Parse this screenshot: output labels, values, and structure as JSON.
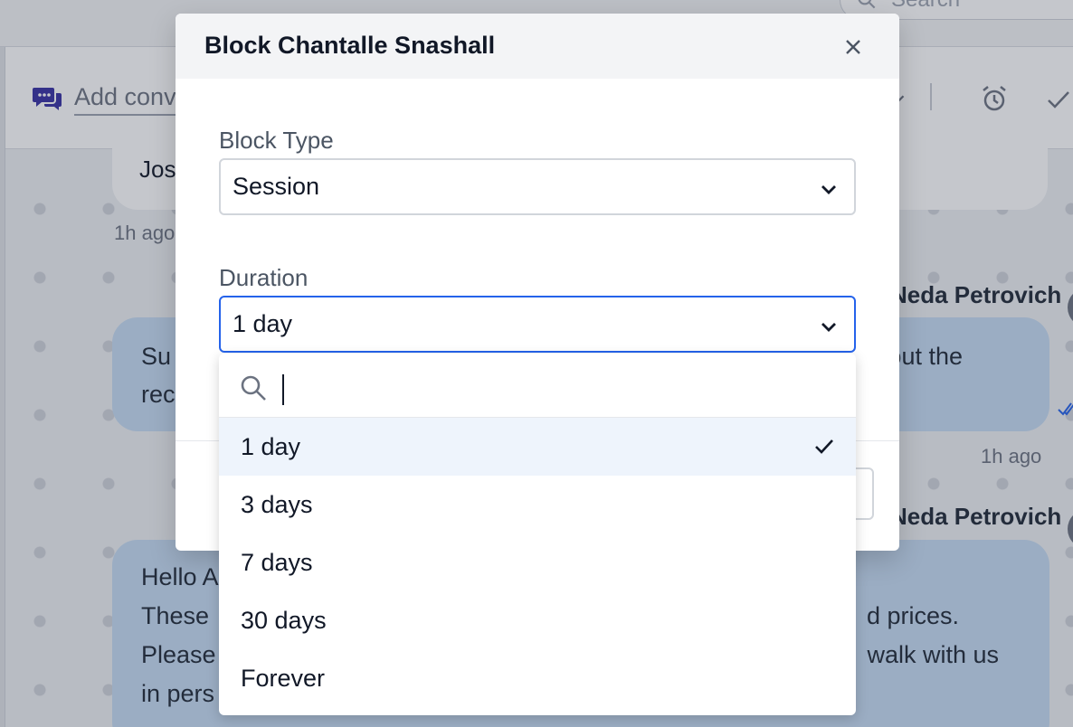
{
  "app": {
    "search_placeholder": "Search",
    "conversation_input_placeholder": "Add conversation title"
  },
  "chat": {
    "incoming_snippet": "Jos",
    "incoming_time": "1h ago",
    "message_1": {
      "sender": "Neda Petrovich",
      "line1_start": "Su",
      "line1_end": "out the",
      "line2_start": "rec"
    },
    "message_2_time": "1h ago",
    "message_2": {
      "sender": "Neda Petrovich",
      "line1_start": "Hello A",
      "line2_start": "These",
      "line2_end": "d prices.",
      "line3_start": "Please",
      "line3_end": "walk with us",
      "line4_start": "in pers"
    }
  },
  "modal": {
    "title": "Block Chantalle Snashall",
    "block_type_label": "Block Type",
    "block_type_value": "Session",
    "duration_label": "Duration",
    "duration_value": "1 day"
  },
  "dropdown": {
    "search_value": "",
    "options": [
      "1 day",
      "3 days",
      "7 days",
      "30 days",
      "Forever"
    ],
    "selected_index": 0
  },
  "icons": {
    "search": "search-icon",
    "conversation": "chat-bubbles-icon",
    "close": "close-icon",
    "chevron": "chevron-down-icon",
    "check": "check-icon",
    "alarm": "alarm-clock-icon"
  },
  "colors": {
    "accent_focus": "#2563eb",
    "brand_icon": "#3730a3",
    "message_bubble": "#c5dcf3",
    "selected_option_bg": "#eef4fc"
  }
}
